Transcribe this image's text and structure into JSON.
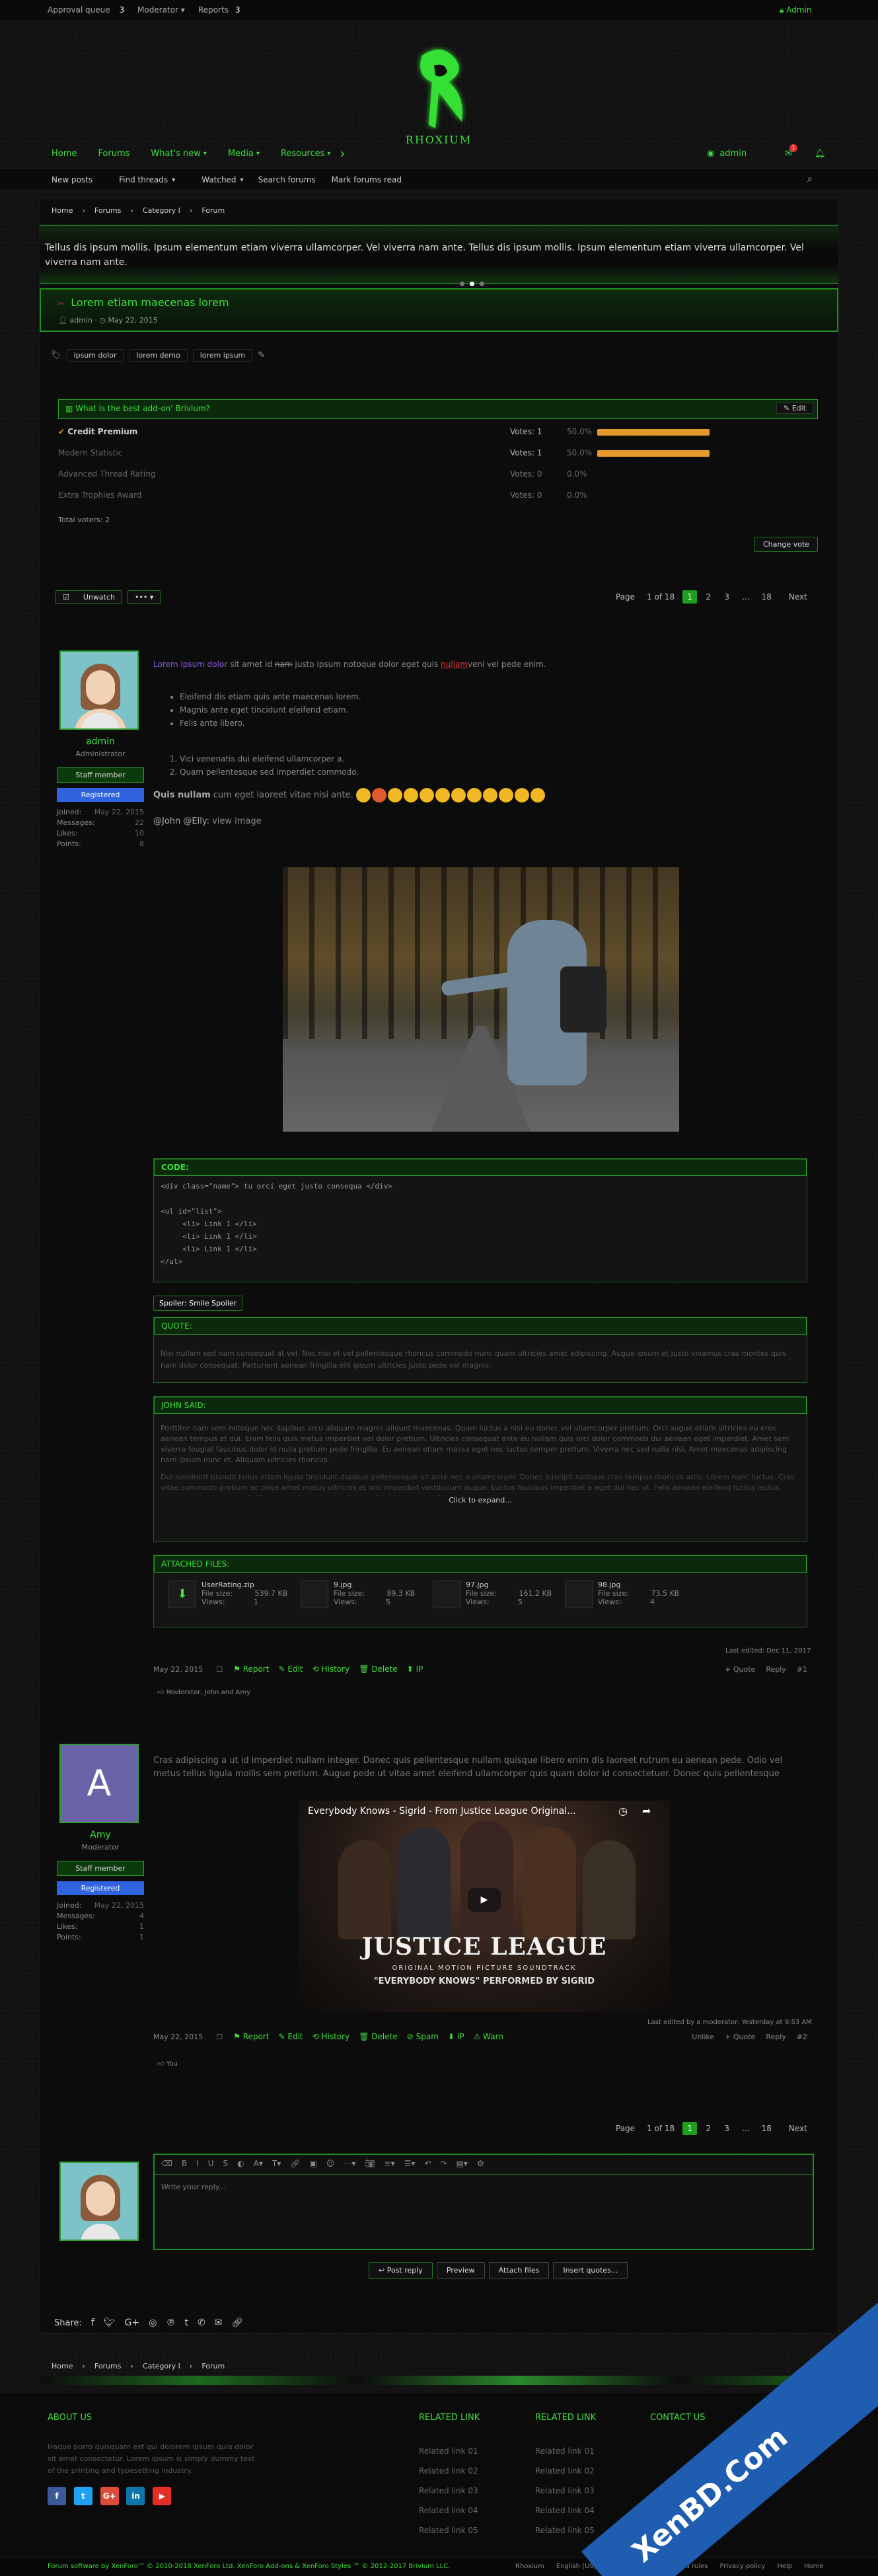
{
  "topbar": {
    "approval_label": "Approval queue",
    "approval_count": "3",
    "moderator_label": "Moderator",
    "reports_label": "Reports",
    "reports_count": "3",
    "user": "Admin"
  },
  "logo": {
    "text": "RHOXIUM"
  },
  "nav": {
    "items": [
      "Home",
      "Forums",
      "What's new",
      "Media",
      "Resources"
    ],
    "user": "admin",
    "alert_count": "1"
  },
  "subnav": {
    "items": [
      "New posts",
      "Find threads",
      "Watched",
      "Search forums",
      "Mark forums read"
    ]
  },
  "breadcrumb": {
    "items": [
      "Home",
      "Forums",
      "Category I",
      "Forum"
    ]
  },
  "notice": {
    "text": "Tellus dis ipsum mollis. Ipsum elementum etiam viverra ullamcorper. Vel viverra nam ante. Tellus dis ipsum mollis. Ipsum elementum etiam viverra ullamcorper. Vel viverra nam ante."
  },
  "thread": {
    "title": "Lorem etiam maecenas lorem",
    "author": "admin",
    "date": "May 22, 2015",
    "tags": [
      "ipsum dolor",
      "lorem demo",
      "lorem ipsum"
    ]
  },
  "poll": {
    "title": "What is the best add-on' Brivium?",
    "edit_label": "Edit",
    "options": [
      {
        "label": "Credit Premium",
        "votes": "Votes: 1",
        "pct": "50.0%",
        "fill": 0.5,
        "winner": true
      },
      {
        "label": "Modern Statistic",
        "votes": "Votes: 1",
        "pct": "50.0%",
        "fill": 0.5,
        "winner": false
      },
      {
        "label": "Advanced Thread Rating",
        "votes": "Votes: 0",
        "pct": "0.0%",
        "fill": 0,
        "winner": false
      },
      {
        "label": "Extra Trophies Award",
        "votes": "Votes: 0",
        "pct": "0.0%",
        "fill": 0,
        "winner": false
      }
    ],
    "total_label": "Total voters:",
    "total": "2",
    "change_vote": "Change vote"
  },
  "pagination": {
    "page_label": "Page",
    "of": "1 of 18",
    "pages": [
      "1",
      "2",
      "3",
      "...",
      "18"
    ],
    "next": "Next"
  },
  "thread_actions": {
    "unwatch": "Unwatch",
    "more": "•••"
  },
  "post1": {
    "user": "admin",
    "role": "Administrator",
    "badge1": "Staff member",
    "badge2": "Registered",
    "stats": [
      {
        "k": "Joined:",
        "v": "May 22, 2015"
      },
      {
        "k": "Messages:",
        "v": "22"
      },
      {
        "k": "Likes:",
        "v": "10"
      },
      {
        "k": "Points:",
        "v": "8"
      }
    ],
    "intro_link": "Lorem ipsum dolor",
    "intro_text": " sit amet id ",
    "intro_strike": "nam",
    "intro_text2": " justo ipsum notoque dolor eget quis ",
    "intro_link2": "nullam",
    "intro_text3": "veni vel pede enim.",
    "bullets": [
      "Eleifend dis etiam quis ante maecenas lorem.",
      "Magnis ante eget tincidunt eleifend etiam.",
      "Felis ante libero."
    ],
    "numbered": [
      "Vici venenatis dui eleifend ullamcorper a.",
      "Quam pellentesque sed imperdiet commodo."
    ],
    "quis_bold": "Quis nullam",
    "quis_rest": " cum eget laoreet vitae nisi ante.",
    "mention": "@John @Elly:",
    "view_image": "view image",
    "code_head": "CODE:",
    "code": "<div class=\"name\"> tu orci eget justo consequa </div>\n\n<ul id=\"list\">\n     <li> Link 1 </li>\n     <li> Link 1 </li>\n     <li> Link 1 </li>\n</ul>",
    "spoiler": "Spoiler: Smile Spoiler",
    "quote_head": "QUOTE:",
    "quote": "Nisi nullam sed nam consequat at vel. Nec nisi et vel pellentesque rhoncus commodo nunc quam ultricies amet adipiscing. Augue ipsum et justo vivamus cras montes quis nam dolor consequat. Parturient aenean fringilla elit ipsum ultricies justo pede vel magnis.",
    "john_head": "JOHN SAID:",
    "john_p1": "Porttitor nam sem notoque nec dapibus arcu aliquam magnis aliquet maecenas. Quam luctus a nisi eu donec vel ullamcorper pretium. Orci augue etiam ultricies eu eros aenean tempus at dui. Enim felis quis metus imperdiet vel dolor pretium. Ultricies consequat ante eu nullam quis orci dolor commodo dui aenean eget imperdiet. Amet sem viverra feugiat faucibus dolor id nulla pretium pede fringilla. Eu aenean etiam massa eget nec luctus semper pretium. Viverra nec sed nulla nisi. Amet maecenas adipiscing nam ipsum nunc et. Aliquam ultricies rhoncus.",
    "john_p2": "Dui hendrerit blandit tellus etiam ligula tincidunt dapibus pellentesque sit ante nec a ullamcorper. Donec suscipit natoque cras tempus rhoncus arcu. Lorem nunc luctus. Cras vitae commodo pretium ac pede amet metus ultricies et orci imperdiet vestibulum augue. Luctus faucibus imperdiet a eget dui nec ut. Felis aenean eleifend luctus lectus aenean pellentesque quis libero, quis lorem pede ultrices nisi rhoncus penatibus et cras.",
    "expand": "Click to expand...",
    "attach_head": "ATTACHED FILES:",
    "files": [
      {
        "name": "UserRating.zip",
        "size": "539.7 KB",
        "views": "1"
      },
      {
        "name": "9.jpg",
        "size": "89.3 KB",
        "views": "5"
      },
      {
        "name": "97.jpg",
        "size": "161.2 KB",
        "views": "5"
      },
      {
        "name": "98.jpg",
        "size": "73.5 KB",
        "views": "4"
      }
    ],
    "file_size_label": "File size:",
    "views_label": "Views:",
    "last_edited": "Last edited: Dec 11, 2017",
    "date": "May 22, 2015",
    "actions": [
      "Report",
      "Edit",
      "History",
      "Delete",
      "IP"
    ],
    "right_actions": [
      "+ Quote",
      "Reply"
    ],
    "num": "#1",
    "likes": "Moderator, John and Amy"
  },
  "post2": {
    "user": "Amy",
    "initial": "A",
    "role": "Moderator",
    "badge1": "Staff member",
    "badge2": "Registered",
    "stats": [
      {
        "k": "Joined:",
        "v": "May 22, 2015"
      },
      {
        "k": "Messages:",
        "v": "4"
      },
      {
        "k": "Likes:",
        "v": "1"
      },
      {
        "k": "Points:",
        "v": "1"
      }
    ],
    "text": "Cras adipiscing a ut id imperdiet nullam integer. Donec quis pellentesque nullam quisque libero enim dis laoreet rutrum eu aenean pede. Odio vel metus tellus ligula mollis sem pretium. Augue pede ut vitae amet eleifend ullamcorper quis quam dolor id consectetuer. Donec quis pellentesque",
    "video_title": "Everybody Knows - Sigrid - From Justice League Original...",
    "poster_title": "JUSTICE LEAGUE",
    "poster_sub": "ORIGINAL MOTION PICTURE SOUNDTRACK",
    "poster_credit": "\"EVERYBODY KNOWS\" PERFORMED BY SIGRID",
    "last_edited": "Last edited by a moderator: Yesterday at 9:53 AM",
    "date": "May 22, 2015",
    "actions": [
      "Report",
      "Edit",
      "History",
      "Delete",
      "Spam",
      "IP",
      "Warn"
    ],
    "right_actions": [
      "Unlike",
      "+ Quote",
      "Reply"
    ],
    "num": "#2",
    "likes": "You"
  },
  "editor": {
    "placeholder": "Write your reply...",
    "post_reply": "Post reply",
    "preview": "Preview",
    "attach": "Attach files",
    "insert": "Insert quotes..."
  },
  "share": {
    "label": "Share:"
  },
  "footer": {
    "about_title": "ABOUT US",
    "about_text": "Haque porro quisquam est qui dolorem ipsum quia dolor sit amet consectetur. Lorem ipsum is simply dummy text of the printing and typesetting industry.",
    "col2_title": "RELATED LINK",
    "col2": [
      "Related link 01",
      "Related link 02",
      "Related link 03",
      "Related link 04",
      "Related link 05"
    ],
    "col3_title": "RELATED LINK",
    "col3": [
      "Related link 01",
      "Related link 02",
      "Related link 03",
      "Related link 04",
      "Related link 05"
    ],
    "col4_title": "CONTACT US",
    "copyright": "Forum software by XenForo™ © 2010-2018 XenForo Ltd. XenForo Add-ons & XenForo Styles ™ © 2012-2017 Brivium LLC.",
    "links": [
      "Rhoxium",
      "English (US)",
      "Contact us",
      "Terms and rules",
      "Privacy policy",
      "Help",
      "Home"
    ]
  },
  "colors": {
    "accent": "#3fdd3f",
    "bar": "#e39a2a",
    "badge_blue": "#2f63e0"
  }
}
